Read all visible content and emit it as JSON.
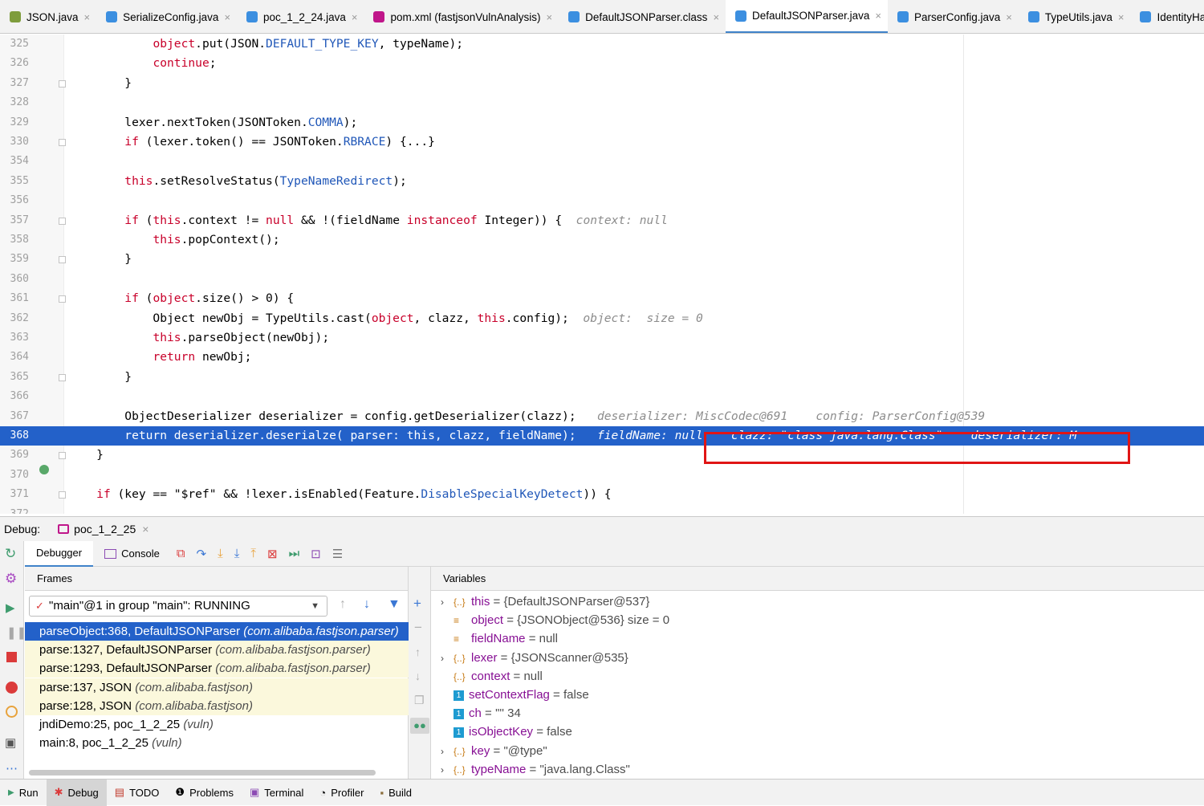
{
  "tabs": [
    {
      "label": "JSON.java",
      "color": "#7e9c3c"
    },
    {
      "label": "SerializeConfig.java",
      "color": "#3c8fe0"
    },
    {
      "label": "poc_1_2_24.java",
      "color": "#3c8fe0"
    },
    {
      "label": "pom.xml (fastjsonVulnAnalysis)",
      "color": "#c0168a"
    },
    {
      "label": "DefaultJSONParser.class",
      "color": "#3c8fe0"
    },
    {
      "label": "DefaultJSONParser.java",
      "color": "#3c8fe0",
      "active": true
    },
    {
      "label": "ParserConfig.java",
      "color": "#3c8fe0"
    },
    {
      "label": "TypeUtils.java",
      "color": "#3c8fe0"
    },
    {
      "label": "IdentityHas",
      "color": "#3c8fe0"
    }
  ],
  "tab_close": "×",
  "editor": {
    "lines": [
      {
        "n": "325",
        "t": "            object.put(JSON.DEFAULT_TYPE_KEY, typeName);"
      },
      {
        "n": "326",
        "t": "            continue;"
      },
      {
        "n": "327",
        "t": "        }"
      },
      {
        "n": "328",
        "t": ""
      },
      {
        "n": "329",
        "t": "        lexer.nextToken(JSONToken.COMMA);"
      },
      {
        "n": "330",
        "t": "        if (lexer.token() == JSONToken.RBRACE) {...}"
      },
      {
        "n": "354",
        "t": ""
      },
      {
        "n": "355",
        "t": "        this.setResolveStatus(TypeNameRedirect);"
      },
      {
        "n": "356",
        "t": ""
      },
      {
        "n": "357",
        "t": "        if (this.context != null && !(fieldName instanceof Integer)) {",
        "hint": "  context: null"
      },
      {
        "n": "358",
        "t": "            this.popContext();"
      },
      {
        "n": "359",
        "t": "        }"
      },
      {
        "n": "360",
        "t": ""
      },
      {
        "n": "361",
        "t": "        if (object.size() > 0) {"
      },
      {
        "n": "362",
        "t": "            Object newObj = TypeUtils.cast(object, clazz, this.config);",
        "hint": "  object:  size = 0"
      },
      {
        "n": "363",
        "t": "            this.parseObject(newObj);"
      },
      {
        "n": "364",
        "t": "            return newObj;"
      },
      {
        "n": "365",
        "t": "        }"
      },
      {
        "n": "366",
        "t": ""
      },
      {
        "n": "367",
        "t": "        ObjectDeserializer deserializer = config.getDeserializer(clazz);",
        "hint": "   deserializer: MiscCodec@691    config: ParserConfig@539"
      },
      {
        "n": "368",
        "t": "        return deserializer.deserialze( parser: this, clazz, fieldName);",
        "hint": "   fieldName: null    clazz: \"class java.lang.Class\"    deserializer: M"
      },
      {
        "n": "369",
        "t": "    }"
      },
      {
        "n": "370",
        "t": ""
      },
      {
        "n": "371",
        "t": "    if (key == \"$ref\" && !lexer.isEnabled(Feature.DisableSpecialKeyDetect)) {"
      },
      {
        "n": "372",
        "t": ""
      }
    ]
  },
  "debug": {
    "label": "Debug:",
    "session": "poc_1_2_25",
    "debugger_tab": "Debugger",
    "console_tab": "Console",
    "frames_title": "Frames",
    "variables_title": "Variables",
    "thread": "\"main\"@1 in group \"main\": RUNNING",
    "frames": [
      {
        "method": "parseObject:368, DefaultJSONParser",
        "pkg": "(com.alibaba.fastjson.parser)"
      },
      {
        "method": "parse:1327, DefaultJSONParser",
        "pkg": "(com.alibaba.fastjson.parser)"
      },
      {
        "method": "parse:1293, DefaultJSONParser",
        "pkg": "(com.alibaba.fastjson.parser)"
      },
      {
        "method": "parse:137, JSON",
        "pkg": "(com.alibaba.fastjson)"
      },
      {
        "method": "parse:128, JSON",
        "pkg": "(com.alibaba.fastjson)"
      },
      {
        "method": "jndiDemo:25, poc_1_2_25",
        "pkg": "(vuln)"
      },
      {
        "method": "main:8, poc_1_2_25",
        "pkg": "(vuln)"
      }
    ],
    "variables": [
      {
        "name": "this",
        "value": " = {DefaultJSONParser@537}",
        "expand": true,
        "icon": "{..}"
      },
      {
        "name": "object",
        "value": " = {JSONObject@536}  size = 0",
        "expand": false,
        "icon": "≡"
      },
      {
        "name": "fieldName",
        "value": " = null",
        "expand": false,
        "icon": "≡"
      },
      {
        "name": "lexer",
        "value": " = {JSONScanner@535}",
        "expand": true,
        "icon": "{..}"
      },
      {
        "name": "context",
        "value": " = null",
        "expand": false,
        "icon": "{..}"
      },
      {
        "name": "setContextFlag",
        "value": " = false",
        "expand": false,
        "icon": "1"
      },
      {
        "name": "ch",
        "value": " = '\"' 34",
        "expand": false,
        "icon": "1"
      },
      {
        "name": "isObjectKey",
        "value": " = false",
        "expand": false,
        "icon": "1"
      },
      {
        "name": "key",
        "value": " = \"@type\"",
        "expand": true,
        "icon": "{..}"
      },
      {
        "name": "typeName",
        "value": " = \"java.lang.Class\"",
        "expand": true,
        "icon": "{..}"
      }
    ]
  },
  "bottom": {
    "run": "Run",
    "debug": "Debug",
    "todo": "TODO",
    "problems": "Problems",
    "terminal": "Terminal",
    "profiler": "Profiler",
    "build": "Build"
  },
  "colors": {
    "accent": "#2361c9",
    "breakpoint_ok": "#59a869",
    "highlight_box": "#e01515"
  }
}
